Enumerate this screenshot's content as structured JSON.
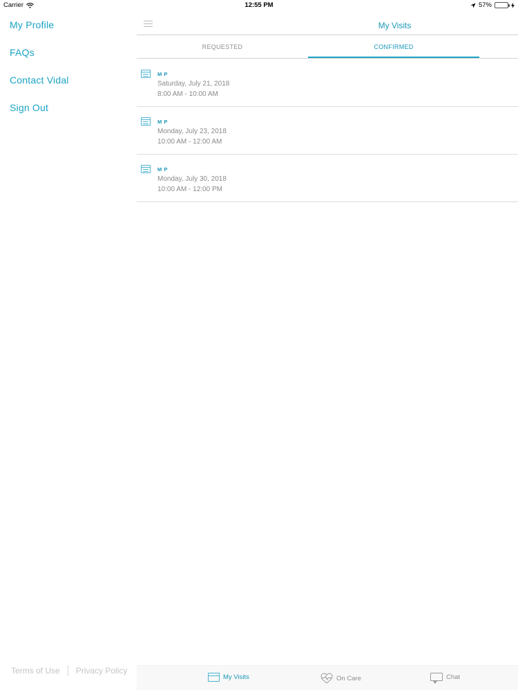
{
  "status_bar": {
    "carrier": "Carrier",
    "time": "12:55 PM",
    "battery_text": "57%",
    "battery_level": 0.57
  },
  "side_menu": {
    "items": [
      {
        "label": "My Profile"
      },
      {
        "label": "FAQs"
      },
      {
        "label": "Contact Vidal"
      },
      {
        "label": "Sign Out"
      }
    ],
    "footer": {
      "terms": "Terms of Use",
      "privacy": "Privacy Policy"
    }
  },
  "header": {
    "title": "My Visits"
  },
  "tabs": {
    "requested": "REQUESTED",
    "confirmed": "CONFIRMED",
    "active": "CONFIRMED"
  },
  "visits": [
    {
      "name": "M P",
      "date": "Saturday, July 21, 2018",
      "time": "8:00 AM - 10:00 AM"
    },
    {
      "name": "M P",
      "date": "Monday, July 23, 2018",
      "time": "10:00 AM - 12:00 AM"
    },
    {
      "name": "M P",
      "date": "Monday, July 30, 2018",
      "time": "10:00 AM - 12:00 PM"
    }
  ],
  "tab_bar": {
    "items": [
      {
        "label": "My Visits",
        "icon": "calendar-icon",
        "active": true
      },
      {
        "label": "On Care",
        "icon": "heartbeat-icon",
        "active": false
      },
      {
        "label": "Chat",
        "icon": "chat-bubble-icon",
        "active": false
      }
    ]
  },
  "colors": {
    "accent": "#1aa3c4",
    "text_muted": "#8a8a8a",
    "battery": "#4cd964"
  }
}
